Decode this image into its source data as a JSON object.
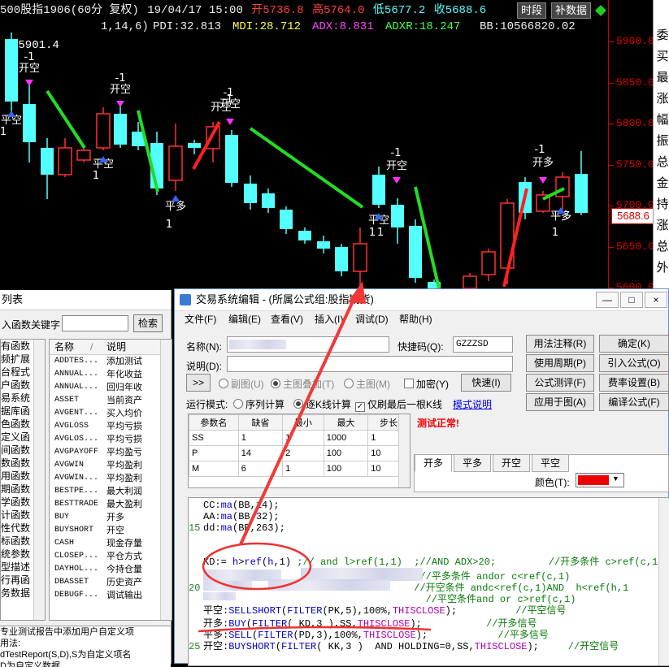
{
  "chart": {
    "title": {
      "name": "500股指1906(60分 复权)",
      "date": "19/04/17 15:00",
      "open_label": "开5736.8",
      "high_label": "高5764.0",
      "low_label": "低5677.2",
      "close_label": "收5688.6"
    },
    "indicator": {
      "params": "1,14,6)",
      "pdi": "PDI:32.813",
      "mdi": "MDI:28.712",
      "adx": "ADX:8.831",
      "adxr": "ADXR:18.247",
      "bb": "BB:10566820.02"
    },
    "buttons": {
      "period": "时段",
      "data": "补数据"
    },
    "max_label": "5901.4",
    "price_ticks": [
      "5900.0",
      "5850.0",
      "5800.0",
      "5750.0",
      "5700.0",
      "5650.0",
      "5600.0"
    ],
    "current_price": "5688.6",
    "signals": [
      {
        "text": "-1",
        "dir": "down"
      },
      {
        "text": "开空",
        "dir": "down"
      },
      {
        "text": "平空",
        "dir": "up"
      },
      {
        "text": "1",
        "dir": "up"
      },
      {
        "text": "-1",
        "dir": "down"
      },
      {
        "text": "开空",
        "dir": "down"
      },
      {
        "text": "平空",
        "dir": "up"
      },
      {
        "text": "1",
        "dir": "up"
      },
      {
        "text": "平多",
        "dir": "up"
      },
      {
        "text": "1",
        "dir": "up"
      },
      {
        "text": "-1",
        "dir": "down"
      },
      {
        "text": "开空",
        "dir": "down"
      },
      {
        "text": "-1",
        "dir": "down"
      },
      {
        "text": "开空",
        "dir": "down"
      },
      {
        "text": "平空",
        "dir": "up"
      },
      {
        "text": "1",
        "dir": "up"
      },
      {
        "text": "1",
        "dir": "up"
      },
      {
        "text": "平多",
        "dir": "up"
      },
      {
        "text": "-1",
        "dir": "down"
      },
      {
        "text": "开多",
        "dir": "down"
      },
      {
        "text": "平多",
        "dir": "up"
      },
      {
        "text": "1",
        "dir": "up"
      },
      {
        "text": "-1",
        "dir": "down"
      },
      {
        "text": "开空",
        "dir": "down"
      }
    ],
    "colors": {
      "up": "#ff3030",
      "down": "#54ffff",
      "trend_up": "#ff2020",
      "trend_down": "#22dd22",
      "signal_down": "#ff33ff",
      "signal_up": "#3366ff"
    }
  },
  "right_sidebar": [
    "委",
    "买",
    "最",
    "涨",
    "幅",
    "振",
    "总",
    "金",
    "持",
    "涨",
    "总",
    "外"
  ],
  "left_panel": {
    "title": "列表",
    "search_label": "入函数关键字",
    "search_button": "检索",
    "categories": [
      "有函数",
      "频扩展",
      "台程式",
      "户函数",
      "易系统",
      "据库函",
      "色函数",
      "定义函",
      "间函数",
      "数函数",
      "用函数",
      "期函数",
      "学函数",
      "计函数",
      "性代数",
      "标函数",
      "统参数",
      "型描述",
      "行再函",
      "务数据"
    ],
    "fn_header": {
      "name": "名称",
      "desc": "说明"
    },
    "functions": [
      {
        "name": "ADDTES...",
        "desc": "添加测试"
      },
      {
        "name": "ANNUAL...",
        "desc": "年化收益"
      },
      {
        "name": "ANNUAL...",
        "desc": "回归年收"
      },
      {
        "name": "ASSET",
        "desc": "当前资产"
      },
      {
        "name": "AVGENT...",
        "desc": "买入均价"
      },
      {
        "name": "AVGLOSS",
        "desc": "平均亏损"
      },
      {
        "name": "AVGLOS...",
        "desc": "平均亏损"
      },
      {
        "name": "AVGPAYOFF",
        "desc": "平均盈亏"
      },
      {
        "name": "AVGWIN",
        "desc": "平均盈利"
      },
      {
        "name": "AVGWIN...",
        "desc": "平均盈利"
      },
      {
        "name": "BESTPE...",
        "desc": "最大利润"
      },
      {
        "name": "BESTTRADE",
        "desc": "最大盈利"
      },
      {
        "name": "BUY",
        "desc": "开多"
      },
      {
        "name": "BUYSHORT",
        "desc": "开空"
      },
      {
        "name": "CASH",
        "desc": "现金存量"
      },
      {
        "name": "CLOSEP...",
        "desc": "平仓方式"
      },
      {
        "name": "DAYHOL...",
        "desc": "今持仓量"
      },
      {
        "name": "DBASSET",
        "desc": "历史资产"
      },
      {
        "name": "DEBUGF...",
        "desc": "调试输出"
      }
    ],
    "description": [
      "专业测试报告中添加用户自定义项",
      "用法:",
      "dTestReport(S,D),S为自定义项名",
      "D为自定义数据"
    ]
  },
  "editor": {
    "title": "交易系统编辑 - (所属公式组:股指期货)",
    "window_buttons": [
      "—",
      "□",
      "×"
    ],
    "menu": [
      "文件(F)",
      "编辑(E)",
      "查看(V)",
      "插入(I)",
      "调试(D)",
      "帮助(H)"
    ],
    "name_label": "名称(N):",
    "shortcut_label": "快捷码(Q):",
    "shortcut_value": "GZZZSD",
    "desc_label": "说明(D):",
    "btn_expand": ">>",
    "radios": [
      "副图(U)",
      "主图叠加(T)",
      "主图(M)"
    ],
    "encrypt_label": "加密(Y)",
    "speed_btn": "快速(I)",
    "run_mode_label": "运行模式:",
    "run_mode_options": [
      "序列计算",
      "逐K线计算"
    ],
    "last_bar_label": "仅刷最后一根K线",
    "mode_desc_link": "模式说明",
    "status_text": "测试正常!",
    "right_buttons": [
      [
        "用法注释(R)",
        "确定(K)"
      ],
      [
        "使用周期(P)",
        "引入公式(O)"
      ],
      [
        "公式测评(F)",
        "费率设置(B)"
      ],
      [
        "应用于图(A)",
        "编译公式(F)"
      ]
    ],
    "param_headers": [
      "参数名",
      "缺省",
      "最小",
      "最大",
      "步长"
    ],
    "params": [
      [
        "SS",
        "1",
        "1",
        "1000",
        "1"
      ],
      [
        "P",
        "14",
        "2",
        "100",
        "10"
      ],
      [
        "M",
        "6",
        "1",
        "100",
        "10"
      ]
    ],
    "signal_tabs": [
      "开多",
      "平多",
      "开空",
      "平空"
    ],
    "color_label": "颜色(T):",
    "color_value": "#ee0000",
    "code_lines": [
      {
        "no": "",
        "html": "CC:<span class='fn'>ma</span>(BB,14);"
      },
      {
        "no": "",
        "html": "AA:<span class='fn'>ma</span>(BB,32);"
      },
      {
        "no": "15",
        "html": "dd:<span class='fn'>ma</span>(BB,263);"
      },
      {
        "no": "",
        "html": ""
      },
      {
        "no": "",
        "html": ""
      },
      {
        "no": "",
        "html": "KD:= <span class='fn'>h</span>&gt;<span class='fn'>ref</span>(<span class='fn'>h</span>,1) <span class='cm'>;// and l&gt;ref(1,1)  ;//AND ADX&gt;20;         //开多条件 c&gt;ref(c,1</span>"
      },
      {
        "no": "",
        "html": "                                     <span class='cm'>//平多条件 andor c&lt;ref(c,1)</span>"
      },
      {
        "no": "20",
        "html": "                                    <span class='cm'>//开空条件 andc&lt;ref(c,1)AND  h&lt;ref(h,1</span>"
      },
      {
        "no": "",
        "html": "                                      <span class='cm'>//平空条件and or c&gt;ref(c,1)</span>"
      },
      {
        "no": "",
        "html": "平空:<span class='fn'>SELLSHORT</span>(<span class='fn'>FILTER</span>(PK,5),100%,<span class='cn'>THISCLOSE</span>);          <span class='cm'>//平空信号</span>"
      },
      {
        "no": "",
        "html": "开多:<span class='fn'>BUY</span>(<span class='fn'>FILTER</span>( KD,3 ),SS,<span class='cn'>THISCLOSE</span>);           <span class='cm'>//开多信号</span>"
      },
      {
        "no": "",
        "html": "平多:<span class='fn'>SELL</span>(<span class='fn'>FILTER</span>(PD,3),100%,<span class='cn'>THISCLOSE</span>);            <span class='cm'>//平多信号</span>"
      },
      {
        "no": "25",
        "html": "开空:<span class='fn'>BUYSHORT</span>(<span class='fn'>FILTER</span>( KK,3 )  AND HOLDING=0,SS,<span class='cn'>THISCLOSE</span>);     <span class='cm'>//开空信号</span>"
      }
    ]
  }
}
